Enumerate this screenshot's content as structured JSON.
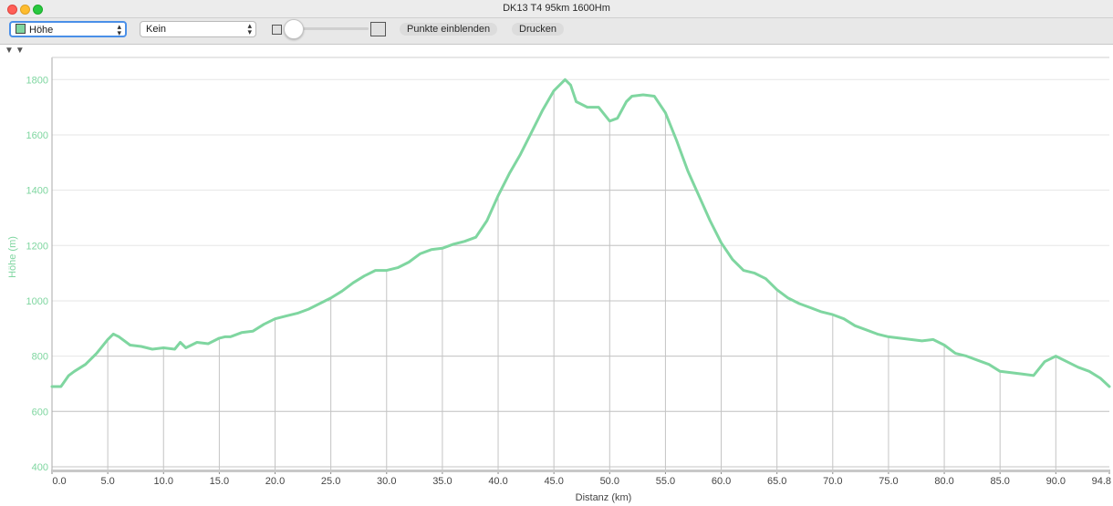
{
  "window": {
    "title": "DK13 T4 95km 1600Hm"
  },
  "toolbar": {
    "primary_select": {
      "value": "Höhe",
      "color": "#7fd6a0"
    },
    "secondary_select": {
      "value": "Kein"
    },
    "show_points_label": "Punkte einblenden",
    "print_label": "Drucken"
  },
  "chart_data": {
    "type": "line",
    "xlabel": "Distanz (km)",
    "ylabel": "Höhe (m)",
    "xlim": [
      0,
      94.8
    ],
    "ylim": [
      390,
      1880
    ],
    "xticks": [
      "0.0",
      "5.0",
      "10.0",
      "15.0",
      "20.0",
      "25.0",
      "30.0",
      "35.0",
      "40.0",
      "45.0",
      "50.0",
      "55.0",
      "60.0",
      "65.0",
      "70.0",
      "75.0",
      "80.0",
      "85.0",
      "90.0",
      "94.8"
    ],
    "yticks": [
      "400",
      "600",
      "800",
      "1000",
      "1200",
      "1400",
      "1600",
      "1800"
    ],
    "grid": true,
    "color": "#7fd6a0",
    "series": [
      {
        "x": [
          0,
          0.8,
          1.5,
          2.0,
          3.0,
          4.0,
          5.0,
          5.5,
          6.0,
          7.0,
          8.0,
          9.0,
          10.0,
          11.0,
          11.5,
          12.0,
          12.5,
          13.0,
          14.0,
          15.0,
          15.5,
          16.0,
          17.0,
          18.0,
          19.0,
          20.0,
          21.0,
          22.0,
          23.0,
          24.0,
          25.0,
          26.0,
          27.0,
          28.0,
          29.0,
          30.0,
          31.0,
          32.0,
          33.0,
          34.0,
          35.0,
          36.0,
          37.0,
          38.0,
          39.0,
          40.0,
          41.0,
          42.0,
          43.0,
          44.0,
          45.0,
          46.0,
          46.5,
          47.0,
          48.0,
          49.0,
          50.0,
          50.7,
          51.5,
          52.0,
          53.0,
          54.0,
          55.0,
          56.0,
          57.0,
          58.0,
          59.0,
          60.0,
          61.0,
          62.0,
          63.0,
          64.0,
          65.0,
          66.0,
          67.0,
          68.0,
          69.0,
          70.0,
          71.0,
          72.0,
          73.0,
          74.0,
          75.0,
          76.0,
          77.0,
          78.0,
          79.0,
          80.0,
          81.0,
          82.0,
          83.0,
          84.0,
          85.0,
          86.0,
          87.0,
          88.0,
          89.0,
          90.0,
          91.0,
          92.0,
          93.0,
          94.0,
          94.8
        ],
        "y": [
          690,
          690,
          730,
          745,
          770,
          810,
          860,
          880,
          870,
          840,
          835,
          825,
          830,
          825,
          850,
          830,
          840,
          850,
          845,
          865,
          870,
          870,
          885,
          890,
          915,
          935,
          945,
          955,
          970,
          990,
          1010,
          1035,
          1065,
          1090,
          1110,
          1110,
          1120,
          1140,
          1170,
          1185,
          1190,
          1205,
          1215,
          1230,
          1290,
          1380,
          1460,
          1530,
          1610,
          1690,
          1760,
          1800,
          1780,
          1720,
          1700,
          1700,
          1650,
          1660,
          1720,
          1740,
          1745,
          1740,
          1680,
          1580,
          1470,
          1380,
          1290,
          1210,
          1150,
          1110,
          1100,
          1080,
          1040,
          1010,
          990,
          975,
          960,
          950,
          935,
          910,
          895,
          880,
          870,
          865,
          860,
          855,
          860,
          840,
          810,
          800,
          785,
          770,
          745,
          740,
          735,
          730,
          780,
          800,
          780,
          760,
          745,
          720,
          690
        ]
      }
    ]
  }
}
